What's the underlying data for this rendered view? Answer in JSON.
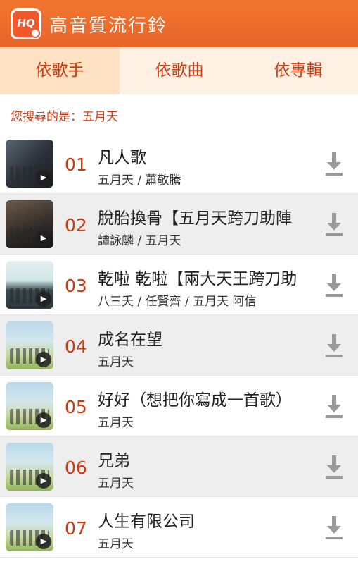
{
  "app": {
    "title": "高音質流行鈴",
    "logo_text": "HQ"
  },
  "tabs": [
    {
      "label": "依歌手",
      "active": true
    },
    {
      "label": "依歌曲",
      "active": false
    },
    {
      "label": "依專輯",
      "active": false
    }
  ],
  "search": {
    "text": "您搜尋的是：五月天"
  },
  "songs": [
    {
      "num": "01",
      "title": "凡人歌",
      "artist": "五月天 / 蕭敬騰"
    },
    {
      "num": "02",
      "title": "脫胎換骨【五月天跨刀助陣",
      "artist": "譚詠麟 / 五月天"
    },
    {
      "num": "03",
      "title": "乾啦 乾啦【兩大天王跨刀助",
      "artist": "八三夭 / 任賢齊 / 五月天 阿信"
    },
    {
      "num": "04",
      "title": "成名在望",
      "artist": "五月天"
    },
    {
      "num": "05",
      "title": "好好（想把你寫成一首歌）",
      "artist": "五月天"
    },
    {
      "num": "06",
      "title": "兄弟",
      "artist": "五月天"
    },
    {
      "num": "07",
      "title": "人生有限公司",
      "artist": "五月天"
    }
  ],
  "icons": {
    "play": "play-icon",
    "download": "download-icon"
  },
  "colors": {
    "accent": "#e8642a",
    "number": "#d0390f",
    "tab_bg": "#fff1e4",
    "tab_active_bg": "#ffe2c4"
  }
}
